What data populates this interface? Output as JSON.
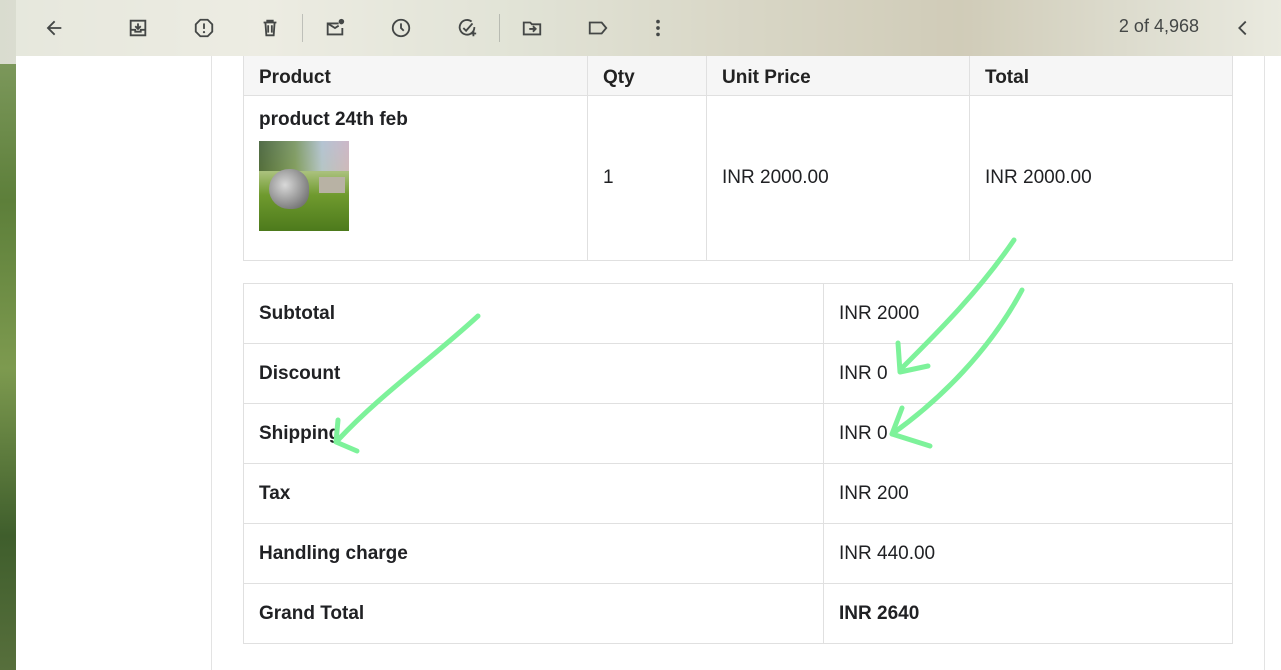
{
  "toolbar": {
    "icons": [
      "back-arrow-icon",
      "archive-icon",
      "report-spam-icon",
      "delete-icon",
      "mark-unread-icon",
      "snooze-icon",
      "add-task-icon",
      "move-to-icon",
      "label-icon",
      "more-options-icon"
    ],
    "pager_text": "2 of 4,968",
    "pager_prev_icon": "chevron-left-icon"
  },
  "product_table": {
    "headers": [
      "Product",
      "Qty",
      "Unit Price",
      "Total"
    ],
    "row": {
      "product_name": "product 24th feb",
      "qty": "1",
      "unit_price": "INR 2000.00",
      "total": "INR 2000.00"
    }
  },
  "summary_table": {
    "rows": [
      {
        "label": "Subtotal",
        "value": "INR 2000"
      },
      {
        "label": "Discount",
        "value": "INR 0"
      },
      {
        "label": "Shipping",
        "value": "INR 0"
      },
      {
        "label": "Tax",
        "value": "INR 200"
      },
      {
        "label": "Handling charge",
        "value": "INR 440.00"
      },
      {
        "label": "Grand Total",
        "value": "INR 2640"
      }
    ]
  },
  "annotation_color": "#7df29a"
}
